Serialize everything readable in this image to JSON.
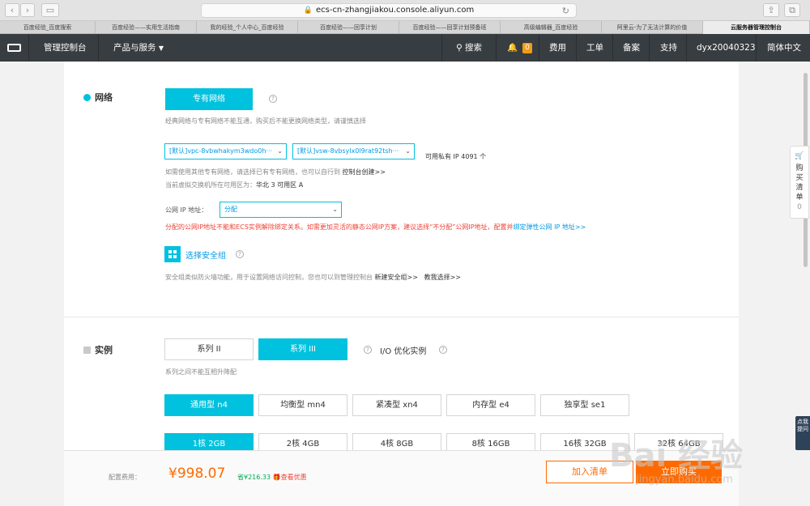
{
  "browser": {
    "url": "ecs-cn-zhangjiakou.console.aliyun.com",
    "tabs": [
      {
        "label": "百度经验_百度搜索",
        "active": false
      },
      {
        "label": "百度经验——实用生活指南",
        "active": false
      },
      {
        "label": "我的经验_个人中心_百度经验",
        "active": false
      },
      {
        "label": "百度经验——回享计划",
        "active": false
      },
      {
        "label": "百度经验——回享计划预备班",
        "active": false
      },
      {
        "label": "高级编辑器_百度经验",
        "active": false
      },
      {
        "label": "阿里云-为了无法计算的价值",
        "active": false
      },
      {
        "label": "云服务器管理控制台",
        "active": true
      }
    ]
  },
  "topnav": {
    "console": "管理控制台",
    "products": "产品与服务",
    "search": "搜索",
    "notifications": "0",
    "fees": "费用",
    "tickets": "工单",
    "filing": "备案",
    "support": "支持",
    "user": "dyx20040323",
    "language": "简体中文"
  },
  "network": {
    "title": "网络",
    "type_button": "专有网络",
    "type_note": "经典网络与专有网络不能互通，购买后不能更换网络类型，请谨慎选择",
    "vpc_select": "[默认]vpc-8vbwhakym3wdo0h···",
    "vsw_select": "[默认]vsw-8vbsylx0l9rat92tsh···",
    "available_ip": "可用私有 IP 4091 个",
    "vpc_note": "如需使用其他专有网络，请选择已有专有网络，也可以自行到",
    "vpc_link": "控制台创建>>",
    "zone_note": "当前虚拟交换机所在可用区为：",
    "zone_value": "华北 3 可用区 A",
    "public_ip_label": "公网 IP 地址：",
    "public_ip_value": "分配",
    "public_ip_warning": "分配的公网IP地址不能和ECS实例解除绑定关系。如需更加灵活的静态公网IP方案，建议选择“不分配”公网IP地址，配置并",
    "public_ip_link": "绑定弹性公网 IP 地址>>",
    "security_group_button": "选择安全组",
    "security_group_note": "安全组类似防火墙功能，用于设置网络访问控制，您也可以到管理控制台",
    "security_group_link": "新建安全组>>",
    "teach_link": "教我选择>>"
  },
  "instance": {
    "title": "实例",
    "series": [
      "系列 II",
      "系列 III"
    ],
    "selected_series": "系列 III",
    "io_optimized": "I/O 优化实例",
    "series_note": "系列之间不能互相升降配",
    "families": [
      "通用型 n4",
      "均衡型 mn4",
      "紧凑型 xn4",
      "内存型 e4",
      "独享型 se1"
    ],
    "selected_family": "通用型 n4",
    "specs": [
      "1核 2GB",
      "2核 4GB",
      "4核 8GB",
      "8核 16GB",
      "16核 32GB",
      "32核 64GB"
    ],
    "selected_spec": "1核 2GB"
  },
  "footer": {
    "price_label": "配置费用：",
    "price": "¥998.07",
    "saving": "省¥216.33",
    "offer": "查看优惠",
    "add_cart": "加入清单",
    "buy_now": "立即购买"
  },
  "side": {
    "cart_label": "购买清单",
    "cart_count": "0",
    "help_label": "点我提问"
  },
  "watermark": {
    "main": "Bai 经验",
    "sub": "jingyan.baidu.com"
  },
  "colors": {
    "accent": "#00c1de",
    "orange": "#ff6a00",
    "nav": "#373d41",
    "warning": "#f04134",
    "link": "#0099e6"
  }
}
